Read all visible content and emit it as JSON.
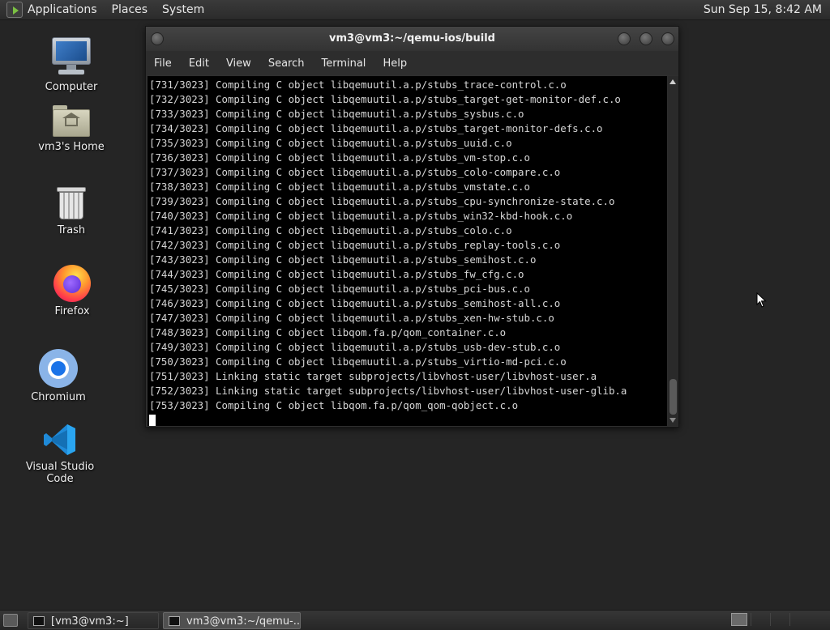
{
  "top_panel": {
    "menus": [
      "Applications",
      "Places",
      "System"
    ],
    "clock": "Sun Sep 15,  8:42 AM"
  },
  "desktop_icons": [
    {
      "label": "Computer",
      "icon": "computer-icon"
    },
    {
      "label": "vm3's Home",
      "icon": "home-folder-icon"
    },
    {
      "label": "Trash",
      "icon": "trash-icon"
    },
    {
      "label": "Firefox",
      "icon": "firefox-icon"
    },
    {
      "label": "Chromium",
      "icon": "chromium-icon"
    },
    {
      "label": "Visual Studio Code",
      "icon": "vscode-icon"
    }
  ],
  "terminal": {
    "title": "vm3@vm3:~/qemu-ios/build",
    "menus": [
      "File",
      "Edit",
      "View",
      "Search",
      "Terminal",
      "Help"
    ],
    "lines": [
      "[731/3023] Compiling C object libqemuutil.a.p/stubs_trace-control.c.o",
      "[732/3023] Compiling C object libqemuutil.a.p/stubs_target-get-monitor-def.c.o",
      "[733/3023] Compiling C object libqemuutil.a.p/stubs_sysbus.c.o",
      "[734/3023] Compiling C object libqemuutil.a.p/stubs_target-monitor-defs.c.o",
      "[735/3023] Compiling C object libqemuutil.a.p/stubs_uuid.c.o",
      "[736/3023] Compiling C object libqemuutil.a.p/stubs_vm-stop.c.o",
      "[737/3023] Compiling C object libqemuutil.a.p/stubs_colo-compare.c.o",
      "[738/3023] Compiling C object libqemuutil.a.p/stubs_vmstate.c.o",
      "[739/3023] Compiling C object libqemuutil.a.p/stubs_cpu-synchronize-state.c.o",
      "[740/3023] Compiling C object libqemuutil.a.p/stubs_win32-kbd-hook.c.o",
      "[741/3023] Compiling C object libqemuutil.a.p/stubs_colo.c.o",
      "[742/3023] Compiling C object libqemuutil.a.p/stubs_replay-tools.c.o",
      "[743/3023] Compiling C object libqemuutil.a.p/stubs_semihost.c.o",
      "[744/3023] Compiling C object libqemuutil.a.p/stubs_fw_cfg.c.o",
      "[745/3023] Compiling C object libqemuutil.a.p/stubs_pci-bus.c.o",
      "[746/3023] Compiling C object libqemuutil.a.p/stubs_semihost-all.c.o",
      "[747/3023] Compiling C object libqemuutil.a.p/stubs_xen-hw-stub.c.o",
      "[748/3023] Compiling C object libqom.fa.p/qom_container.c.o",
      "[749/3023] Compiling C object libqemuutil.a.p/stubs_usb-dev-stub.c.o",
      "[750/3023] Compiling C object libqemuutil.a.p/stubs_virtio-md-pci.c.o",
      "[751/3023] Linking static target subprojects/libvhost-user/libvhost-user.a",
      "[752/3023] Linking static target subprojects/libvhost-user/libvhost-user-glib.a",
      "[753/3023] Compiling C object libqom.fa.p/qom_qom-qobject.c.o"
    ]
  },
  "taskbar": {
    "tasks": [
      "[vm3@vm3:~]",
      "vm3@vm3:~/qemu-..."
    ]
  }
}
